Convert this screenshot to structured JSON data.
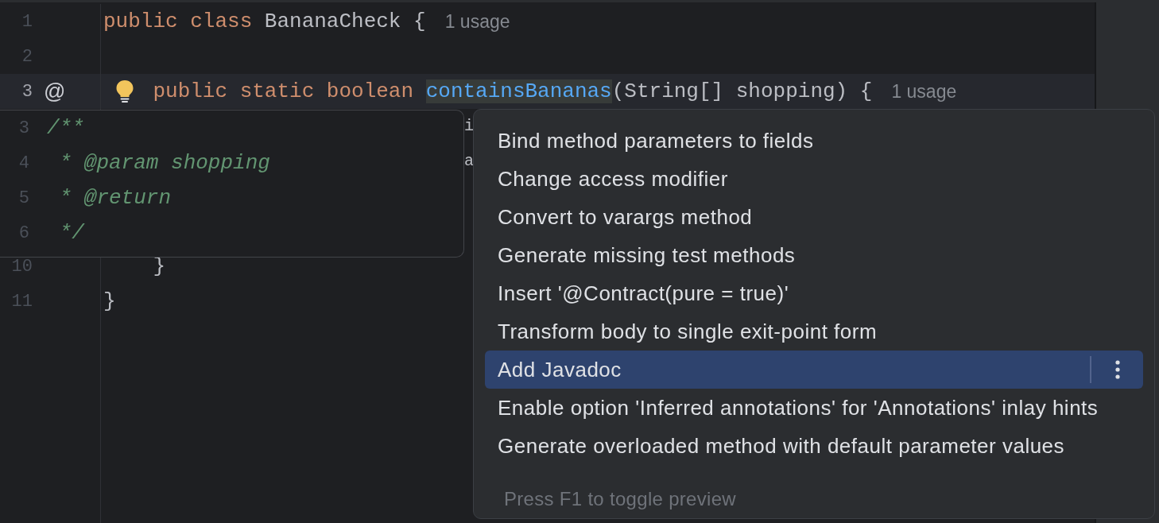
{
  "editor": {
    "lines": [
      {
        "kind": "code",
        "number": "1",
        "current": false,
        "bulb": false,
        "tokens": [
          {
            "kind": "keyword",
            "text": "public class ",
            "highlighted": false
          },
          {
            "kind": "plain",
            "text": "BananaCheck {",
            "highlighted": false
          }
        ],
        "hint": "1 usage"
      },
      {
        "kind": "code",
        "number": "2",
        "current": false,
        "bulb": false
      },
      {
        "kind": "code",
        "number": "3",
        "current": true,
        "bulb": true,
        "gutter_mark": "@",
        "tokens": [
          {
            "kind": "keyword",
            "text": "    public static boolean ",
            "highlighted": false
          },
          {
            "kind": "method",
            "text": "containsBananas",
            "highlighted": true
          },
          {
            "kind": "plain",
            "text": "(String[] shopping) {",
            "highlighted": false
          }
        ],
        "hint": "1 usage"
      },
      {
        "kind": "covered",
        "fragments": [
          "i",
          "a"
        ]
      },
      {
        "kind": "code",
        "number": "10",
        "current": false,
        "bulb": false,
        "tokens": [
          {
            "kind": "plain",
            "text": "    }",
            "highlighted": false
          }
        ]
      },
      {
        "kind": "code",
        "number": "11",
        "current": false,
        "bulb": false,
        "tokens": [
          {
            "kind": "plain",
            "text": "}",
            "highlighted": false
          }
        ]
      }
    ]
  },
  "preview": {
    "lines": [
      {
        "number": "3",
        "text": "/**"
      },
      {
        "number": "4",
        "text": " * @param shopping"
      },
      {
        "number": "5",
        "text": " * @return"
      },
      {
        "number": "6",
        "text": " */"
      }
    ]
  },
  "menu": {
    "items": [
      {
        "label": "Bind method parameters to fields",
        "selected": false
      },
      {
        "label": "Change access modifier",
        "selected": false
      },
      {
        "label": "Convert to varargs method",
        "selected": false
      },
      {
        "label": "Generate missing test methods",
        "selected": false
      },
      {
        "label": "Insert '@Contract(pure = true)'",
        "selected": false
      },
      {
        "label": "Transform body to single exit-point form",
        "selected": false
      },
      {
        "label": "Add Javadoc",
        "selected": true
      },
      {
        "label": "Enable option 'Inferred annotations' for 'Annotations' inlay hints",
        "selected": false
      },
      {
        "label": "Generate overloaded method with default parameter values",
        "selected": false
      }
    ],
    "footer": "Press F1 to toggle preview"
  }
}
